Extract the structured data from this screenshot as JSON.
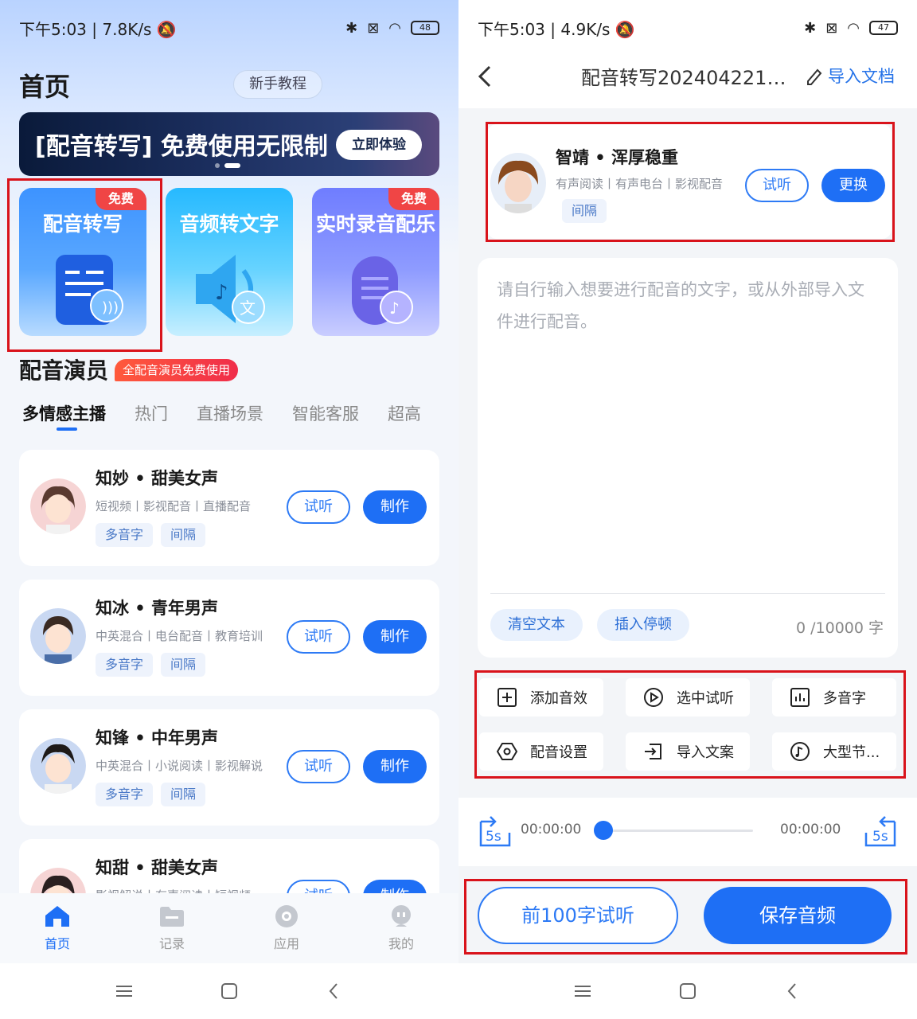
{
  "left": {
    "status": {
      "time": "下午5:03",
      "speed": "7.8K/s",
      "battery": "48"
    },
    "page_title": "首页",
    "tutorial_button": "新手教程",
    "banner": {
      "text": "[配音转写] 免费使用无限制",
      "button": "立即体验"
    },
    "features": [
      {
        "title": "配音转写",
        "badge": "免费"
      },
      {
        "title": "音频转文字",
        "badge": ""
      },
      {
        "title": "实时录音配乐",
        "badge": "免费"
      }
    ],
    "section_title": "配音演员",
    "section_badge": "全配音演员免费使用",
    "tabs": [
      "多情感主播",
      "热门",
      "直播场景",
      "智能客服",
      "超高"
    ],
    "actors": [
      {
        "name": "知妙 • 甜美女声",
        "desc": "短视频丨影视配音丨直播配音",
        "tags": [
          "多音字",
          "间隔"
        ],
        "listen": "试听",
        "make": "制作"
      },
      {
        "name": "知冰 • 青年男声",
        "desc": "中英混合丨电台配音丨教育培训",
        "tags": [
          "多音字",
          "间隔"
        ],
        "listen": "试听",
        "make": "制作"
      },
      {
        "name": "知锋 • 中年男声",
        "desc": "中英混合丨小说阅读丨影视解说",
        "tags": [
          "多音字",
          "间隔"
        ],
        "listen": "试听",
        "make": "制作"
      },
      {
        "name": "知甜 • 甜美女声",
        "desc": "影视解说丨有声阅读丨短视频",
        "tags": [],
        "listen": "试听",
        "make": "制作"
      }
    ],
    "nav": [
      "首页",
      "记录",
      "应用",
      "我的"
    ]
  },
  "right": {
    "status": {
      "time": "下午5:03",
      "speed": "4.9K/s",
      "battery": "47"
    },
    "doc_title": "配音转写2024042217...",
    "import_doc": "导入文档",
    "voice": {
      "name": "智靖 • 浑厚稳重",
      "desc": "有声阅读丨有声电台丨影视配音",
      "tag": "间隔",
      "listen": "试听",
      "change": "更换"
    },
    "editor": {
      "placeholder": "请自行输入想要进行配音的文字，或从外部导入文件进行配音。",
      "clear": "清空文本",
      "insert_pause": "插入停顿",
      "count": "0 /10000 字"
    },
    "tools": [
      "添加音效",
      "选中试听",
      "多音字",
      "配音设置",
      "导入文案",
      "大型节..."
    ],
    "player": {
      "start_time": "00:00:00",
      "end_time": "00:00:00",
      "skip_back": "5s",
      "skip_fwd": "5s",
      "progress": 0
    },
    "preview_button": "前100字试听",
    "save_button": "保存音频"
  },
  "colors": {
    "accent": "#1e6ff5",
    "highlight": "#d9131b",
    "badge": "#f04545"
  }
}
